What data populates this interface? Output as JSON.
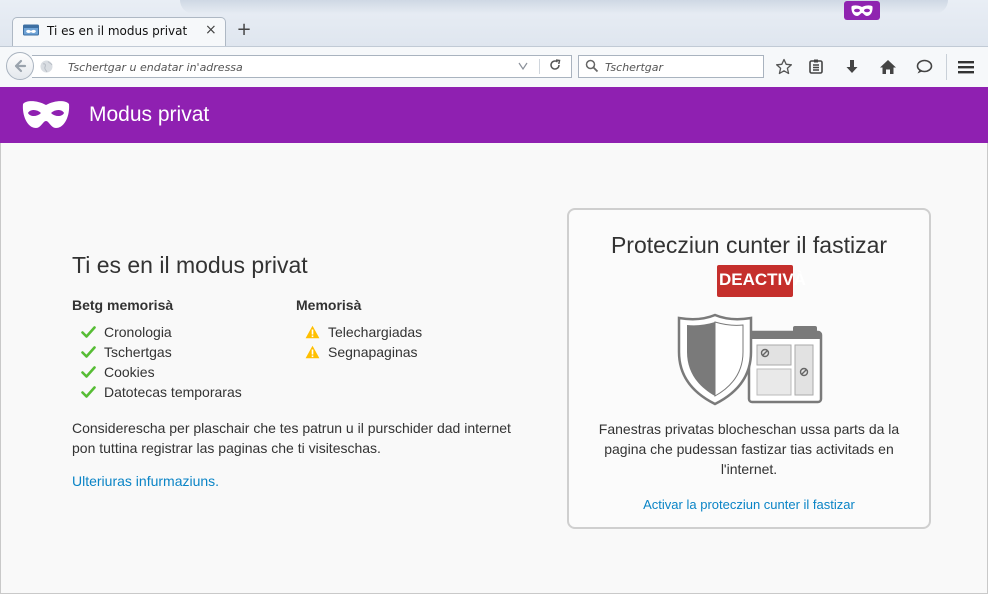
{
  "colors": {
    "private_purple": "#8f20b1",
    "link_blue": "#0a84c6",
    "check_green": "#57bd35",
    "warning_yellow": "#ffbf00",
    "deactivated_red": "#c52f2c"
  },
  "tab": {
    "title": "Ti es en il modus privat",
    "favicon": "private-browsing-icon",
    "close_label": "×"
  },
  "new_tab_label": "+",
  "urlbar": {
    "placeholder": "Tschertgar u endatar in'adressa"
  },
  "searchbar": {
    "placeholder": "Tschertgar"
  },
  "toolbar_icons": [
    "bookmark-star-icon",
    "reading-list-icon",
    "downloads-icon",
    "home-icon",
    "chat-icon",
    "menu-icon"
  ],
  "header": {
    "title": "Modus privat"
  },
  "main": {
    "title": "Ti es en il modus privat",
    "not_saved": {
      "title": "Betg memorisà",
      "items": [
        "Cronologia",
        "Tschertgas",
        "Cookies",
        "Datotecas temporaras"
      ]
    },
    "saved": {
      "title": "Memorisà",
      "items": [
        "Telechargiadas",
        "Segnapaginas"
      ]
    },
    "description": "Considerescha per plaschair che tes patrun u il purschider dad internet pon tuttina registrar las paginas che ti visiteschas.",
    "learn_more": "Ulteriuras infurmaziuns."
  },
  "tracking": {
    "title": "Protecziun cunter il fastizar",
    "status": "DEACTIVÀ",
    "description": "Fanestras privatas blocheschan ussa parts da la pagina che pudessan fastizar tias activitads en l'internet.",
    "enable_link": "Activar la protecziun cunter il fastizar"
  }
}
